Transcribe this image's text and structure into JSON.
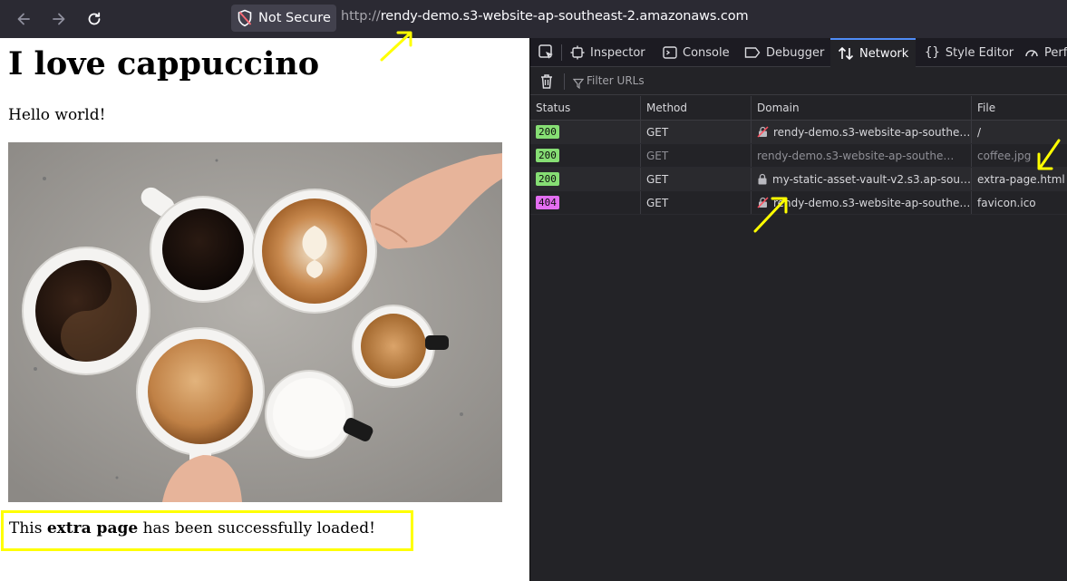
{
  "browser": {
    "security_label": "Not Secure",
    "url_scheme": "http://",
    "url_host": "rendy-demo.s3-website-ap-southeast-2.amazonaws.com"
  },
  "page": {
    "title": "I love cappuccino",
    "greeting": "Hello world!",
    "extra_prefix": "This ",
    "extra_bold": "extra page",
    "extra_suffix": " has been successfully loaded!"
  },
  "devtools": {
    "tabs": [
      {
        "label": "Inspector",
        "icon": "inspector-icon"
      },
      {
        "label": "Console",
        "icon": "console-icon"
      },
      {
        "label": "Debugger",
        "icon": "debugger-icon"
      },
      {
        "label": "Network",
        "icon": "network-icon",
        "active": true
      },
      {
        "label": "Style Editor",
        "icon": "style-editor-icon"
      },
      {
        "label": "Perf",
        "icon": "performance-icon"
      }
    ],
    "filter_placeholder": "Filter URLs",
    "columns": [
      "Status",
      "Method",
      "Domain",
      "File"
    ],
    "rows": [
      {
        "status": "200",
        "method": "GET",
        "domain": "rendy-demo.s3-website-ap-southeas...",
        "file": "/",
        "domain_icon": "insecure-icon"
      },
      {
        "status": "200",
        "method": "GET",
        "domain": "rendy-demo.s3-website-ap-southeast-2....",
        "file": "coffee.jpg",
        "domain_icon": ""
      },
      {
        "status": "200",
        "method": "GET",
        "domain": "my-static-asset-vault-v2.s3.ap-south...",
        "file": "extra-page.html",
        "domain_icon": "lock-icon"
      },
      {
        "status": "404",
        "method": "GET",
        "domain": "rendy-demo.s3-website-ap-southeas...",
        "file": "favicon.ico",
        "domain_icon": "insecure-icon"
      }
    ]
  },
  "colors": {
    "status_ok": "#86de74",
    "status_error": "#e36ef1",
    "annotation": "#ffff00",
    "active_tab": "#4f8cf6"
  }
}
